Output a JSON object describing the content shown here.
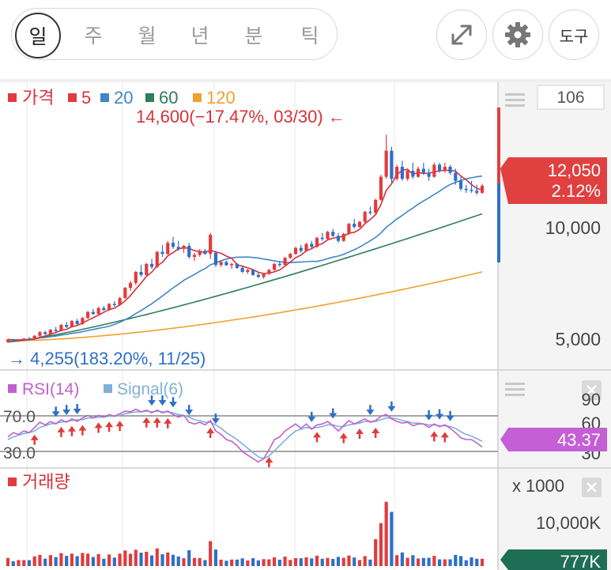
{
  "toolbar": {
    "periods": [
      "일",
      "주",
      "월",
      "년",
      "분",
      "틱"
    ],
    "active_period": "일",
    "expand_icon": "expand-diagonal-icon",
    "settings_icon": "gear-icon",
    "tools_label": "도구"
  },
  "price_panel": {
    "legend_title": "가격",
    "ma_labels": [
      "5",
      "20",
      "60",
      "120"
    ],
    "high_label": "14,600(−17.47%, 03/30) ←",
    "low_label": "→ 4,255(183.20%, 11/25)",
    "current_price": "12,050",
    "current_change": "2.12%",
    "axis_ticks": [
      "10,000",
      "5,000"
    ],
    "top_box_value": "106"
  },
  "rsi_panel": {
    "legend_rsi": "RSI(14)",
    "legend_signal": "Signal(6)",
    "levels": [
      "70.0",
      "30.0"
    ],
    "axis_ticks": [
      "90",
      "60",
      "30"
    ],
    "current_value": "43.37"
  },
  "volume_panel": {
    "title": "거래량",
    "unit_label": "x 1000",
    "axis_tick": "10,000K",
    "current_value": "777K"
  },
  "colors": {
    "up": "#e03c3c",
    "down": "#2d6fc8",
    "ma5": "#d6313b",
    "ma20": "#3f86c9",
    "ma60": "#2e7d5b",
    "ma120": "#f0a030",
    "rsi": "#c060d0",
    "signal": "#7fb0d8",
    "price_badge": "#e04040",
    "rsi_badge": "#c45fd6",
    "volume_badge": "#1e6d55"
  },
  "chart_data": {
    "type": "candlestick",
    "title": "",
    "price_range": [
      3800,
      15800
    ],
    "candles": [
      [
        4255,
        4400,
        4200,
        4380
      ],
      [
        4380,
        4420,
        4300,
        4320
      ],
      [
        4320,
        4400,
        4250,
        4350
      ],
      [
        4350,
        4450,
        4300,
        4420
      ],
      [
        4420,
        4500,
        4350,
        4380
      ],
      [
        4380,
        4600,
        4350,
        4560
      ],
      [
        4560,
        4800,
        4500,
        4740
      ],
      [
        4740,
        4800,
        4600,
        4650
      ],
      [
        4650,
        4900,
        4600,
        4860
      ],
      [
        4860,
        5000,
        4750,
        4800
      ],
      [
        4800,
        5150,
        4780,
        5100
      ],
      [
        5100,
        5250,
        4950,
        5000
      ],
      [
        5000,
        5350,
        4980,
        5300
      ],
      [
        5300,
        5400,
        5100,
        5150
      ],
      [
        5150,
        5500,
        5100,
        5450
      ],
      [
        5450,
        5800,
        5400,
        5750
      ],
      [
        5750,
        5900,
        5600,
        5650
      ],
      [
        5650,
        6000,
        5600,
        5950
      ],
      [
        5950,
        6050,
        5800,
        5850
      ],
      [
        5850,
        6200,
        5800,
        6150
      ],
      [
        6150,
        6300,
        6000,
        6100
      ],
      [
        6100,
        6500,
        6050,
        6450
      ],
      [
        6450,
        7000,
        6400,
        6950
      ],
      [
        6950,
        7300,
        6800,
        7200
      ],
      [
        7200,
        7800,
        7100,
        7750
      ],
      [
        7750,
        8100,
        7500,
        7600
      ],
      [
        7600,
        8200,
        7550,
        8150
      ],
      [
        8150,
        8400,
        7900,
        8000
      ],
      [
        8000,
        8800,
        7950,
        8750
      ],
      [
        8750,
        9100,
        8500,
        8650
      ],
      [
        8650,
        9300,
        8600,
        9200
      ],
      [
        9200,
        9500,
        8900,
        9000
      ],
      [
        9000,
        9300,
        8800,
        8900
      ],
      [
        8900,
        9100,
        8700,
        9050
      ],
      [
        9050,
        9200,
        8400,
        8500
      ],
      [
        8500,
        8700,
        8300,
        8600
      ],
      [
        8600,
        8900,
        8500,
        8800
      ],
      [
        8800,
        8900,
        8600,
        8650
      ],
      [
        8650,
        9700,
        8400,
        9600
      ],
      [
        8700,
        8800,
        8000,
        8100
      ],
      [
        8100,
        8300,
        8000,
        8250
      ],
      [
        8250,
        8300,
        8050,
        8080
      ],
      [
        8080,
        8200,
        7900,
        8150
      ],
      [
        8150,
        8200,
        7900,
        7950
      ],
      [
        7950,
        8050,
        7700,
        7750
      ],
      [
        7750,
        7900,
        7650,
        7850
      ],
      [
        7850,
        7900,
        7550,
        7600
      ],
      [
        7600,
        7700,
        7450,
        7500
      ],
      [
        7500,
        7700,
        7400,
        7650
      ],
      [
        7650,
        7900,
        7600,
        7850
      ],
      [
        7850,
        8200,
        7800,
        8150
      ],
      [
        8150,
        8300,
        8000,
        8100
      ],
      [
        8100,
        8500,
        8050,
        8450
      ],
      [
        8450,
        8700,
        8400,
        8650
      ],
      [
        8650,
        9000,
        8600,
        8950
      ],
      [
        8950,
        9100,
        8700,
        8800
      ],
      [
        8800,
        9200,
        8750,
        9150
      ],
      [
        9150,
        9300,
        8900,
        9000
      ],
      [
        9000,
        9500,
        8950,
        9450
      ],
      [
        9450,
        9700,
        9300,
        9400
      ],
      [
        9400,
        9800,
        9350,
        9750
      ],
      [
        9750,
        9900,
        9500,
        9550
      ],
      [
        9550,
        9700,
        9200,
        9300
      ],
      [
        9300,
        9700,
        9250,
        9650
      ],
      [
        9650,
        10200,
        9600,
        10150
      ],
      [
        10150,
        10400,
        9900,
        10000
      ],
      [
        10000,
        10300,
        9950,
        10250
      ],
      [
        10250,
        10800,
        10200,
        10750
      ],
      [
        10750,
        11000,
        10600,
        10700
      ],
      [
        10700,
        11400,
        10650,
        11350
      ],
      [
        11350,
        12600,
        11300,
        12500
      ],
      [
        12500,
        14600,
        12400,
        13800
      ],
      [
        13800,
        14000,
        12200,
        12400
      ],
      [
        12400,
        13100,
        12300,
        13000
      ],
      [
        13000,
        13300,
        12300,
        12400
      ],
      [
        12400,
        12900,
        12300,
        12800
      ],
      [
        12800,
        13200,
        12400,
        12500
      ],
      [
        12500,
        13000,
        12450,
        12900
      ],
      [
        12900,
        13200,
        12600,
        12700
      ],
      [
        12700,
        12900,
        12300,
        12500
      ],
      [
        12500,
        13200,
        12450,
        13100
      ],
      [
        13100,
        13200,
        12700,
        12800
      ],
      [
        12800,
        13200,
        12700,
        13000
      ],
      [
        13000,
        13100,
        12600,
        12700
      ],
      [
        12700,
        12900,
        12100,
        12300
      ],
      [
        12300,
        12500,
        11800,
        11900
      ],
      [
        11900,
        12100,
        11700,
        11850
      ],
      [
        11850,
        12300,
        11700,
        11800
      ],
      [
        11800,
        12100,
        11600,
        11700
      ],
      [
        11700,
        12150,
        11650,
        12050
      ]
    ],
    "rsi_range": [
      20,
      95
    ],
    "rsi_levels": [
      70,
      30
    ],
    "rsi": [
      55,
      60,
      58,
      62,
      60,
      66,
      72,
      69,
      73,
      70,
      75,
      72,
      76,
      73,
      77,
      80,
      77,
      80,
      78,
      81,
      79,
      82,
      85,
      84,
      87,
      84,
      86,
      83,
      86,
      83,
      85,
      81,
      78,
      80,
      72,
      70,
      72,
      69,
      74,
      62,
      58,
      52,
      50,
      45,
      38,
      34,
      30,
      26,
      30,
      40,
      52,
      55,
      62,
      66,
      70,
      65,
      70,
      64,
      69,
      70,
      73,
      68,
      62,
      68,
      74,
      70,
      73,
      76,
      72,
      74,
      79,
      81,
      76,
      73,
      71,
      72,
      68,
      70,
      70,
      66,
      70,
      67,
      69,
      65,
      60,
      54,
      52,
      52,
      48,
      43.37
    ],
    "signal": [
      52,
      55,
      57,
      59,
      60,
      62,
      66,
      68,
      70,
      71,
      72,
      73,
      74,
      75,
      75,
      77,
      77,
      78,
      78,
      79,
      79,
      80,
      82,
      83,
      84,
      84,
      85,
      84,
      85,
      84,
      84,
      83,
      81,
      80,
      78,
      75,
      74,
      72,
      72,
      69,
      65,
      60,
      56,
      52,
      47,
      42,
      37,
      32,
      30,
      33,
      39,
      45,
      51,
      57,
      62,
      64,
      66,
      65,
      66,
      67,
      69,
      69,
      67,
      67,
      69,
      70,
      71,
      73,
      73,
      73,
      75,
      77,
      77,
      76,
      74,
      73,
      71,
      71,
      70,
      69,
      69,
      68,
      68,
      67,
      65,
      61,
      58,
      56,
      53,
      50
    ]
  }
}
